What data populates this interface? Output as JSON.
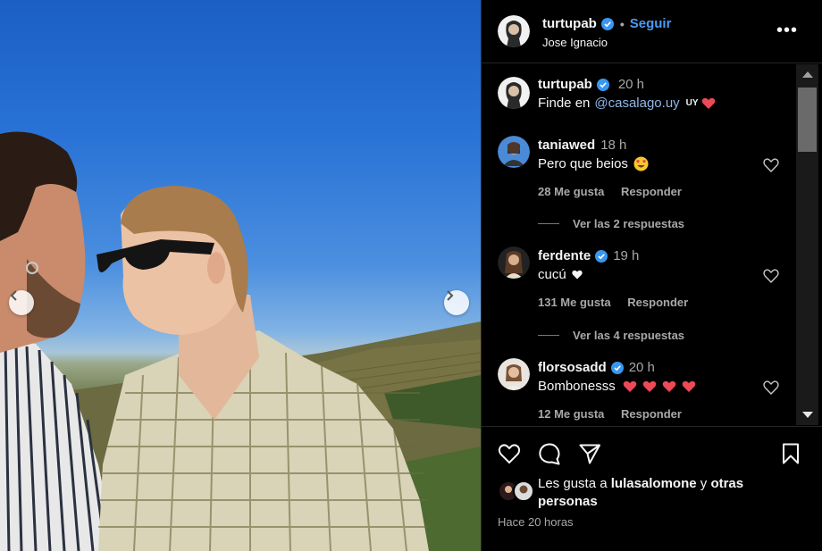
{
  "post": {
    "author": "turtupab",
    "follow_label": "Seguir",
    "location": "Jose Ignacio",
    "more_label": "•••"
  },
  "caption": {
    "user": "turtupab",
    "time": "20 h",
    "text_prefix": "Finde en",
    "mention": "@casalago.uy",
    "flag": "UY"
  },
  "comments": [
    {
      "user": "taniawed",
      "time": "18 h",
      "text": "Pero que beios",
      "likes": "28 Me gusta",
      "reply": "Responder",
      "view_replies": "Ver las 2 respuestas",
      "verified": false
    },
    {
      "user": "ferdente",
      "time": "19 h",
      "text": "cucú",
      "likes": "131 Me gusta",
      "reply": "Responder",
      "view_replies": "Ver las 4 respuestas",
      "verified": true
    },
    {
      "user": "florsosadd",
      "time": "20 h",
      "text": "Bombonesss",
      "likes": "12 Me gusta",
      "reply": "Responder",
      "verified": true
    }
  ],
  "likes": {
    "prefix": "Les gusta a",
    "user": "lulasalomone",
    "middle": "y",
    "suffix": "otras personas"
  },
  "timestamp": "Hace 20 horas",
  "colors": {
    "accent": "#4a9cf6",
    "heart": "#ed4956",
    "mention": "#8fb8e8"
  }
}
